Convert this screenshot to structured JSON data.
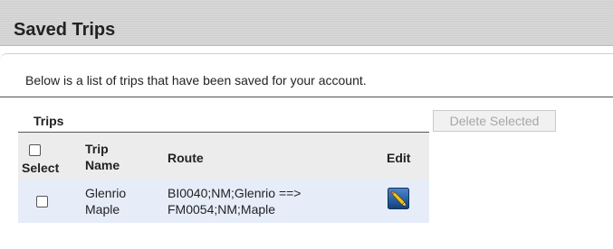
{
  "header": {
    "title": "Saved Trips"
  },
  "intro_text": "Below is a list of trips that have been saved for your account.",
  "trips": {
    "label": "Trips",
    "delete_button": "Delete Selected",
    "columns": {
      "select": "Select",
      "trip_name_line1": "Trip",
      "trip_name_line2": "Name",
      "route": "Route",
      "edit": "Edit"
    },
    "rows": [
      {
        "name_line1": "Glenrio",
        "name_line2": "Maple",
        "route_line1": "BI0040;NM;Glenrio ==>",
        "route_line2": "FM0054;NM;Maple"
      }
    ]
  },
  "colors": {
    "header_bg": "#d3d3d3",
    "row_bg": "#e6edf9",
    "header_row_bg": "#ececec",
    "edit_icon_blue": "#1f5fa8"
  },
  "icons": {
    "edit": "pencil-edit-icon"
  }
}
